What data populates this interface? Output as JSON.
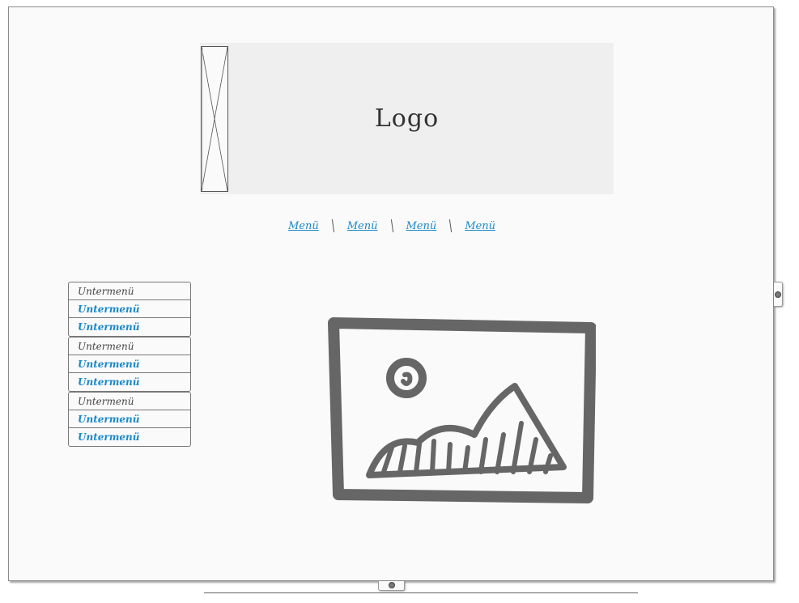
{
  "header": {
    "logo_text": "Logo"
  },
  "top_menu": {
    "items": [
      {
        "label": "Menü"
      },
      {
        "label": "Menü"
      },
      {
        "label": "Menü"
      },
      {
        "label": "Menü"
      }
    ]
  },
  "submenu": {
    "groups": [
      {
        "items": [
          {
            "label": "Untermenü",
            "kind": "header"
          },
          {
            "label": "Untermenü",
            "kind": "link"
          },
          {
            "label": "Untermenü",
            "kind": "link"
          }
        ]
      },
      {
        "items": [
          {
            "label": "Untermenü",
            "kind": "header"
          },
          {
            "label": "Untermenü",
            "kind": "link"
          },
          {
            "label": "Untermenü",
            "kind": "link"
          }
        ]
      },
      {
        "items": [
          {
            "label": "Untermenü",
            "kind": "header"
          },
          {
            "label": "Untermenü",
            "kind": "link"
          },
          {
            "label": "Untermenü",
            "kind": "link"
          }
        ]
      }
    ]
  },
  "icons": {
    "logo_placeholder": "image-placeholder-icon",
    "main_image": "image-icon"
  },
  "colors": {
    "link": "#1a88c9",
    "text": "#444444",
    "canvas": "#fafafa",
    "logo_bg": "#efefef",
    "sketch": "#666666"
  }
}
